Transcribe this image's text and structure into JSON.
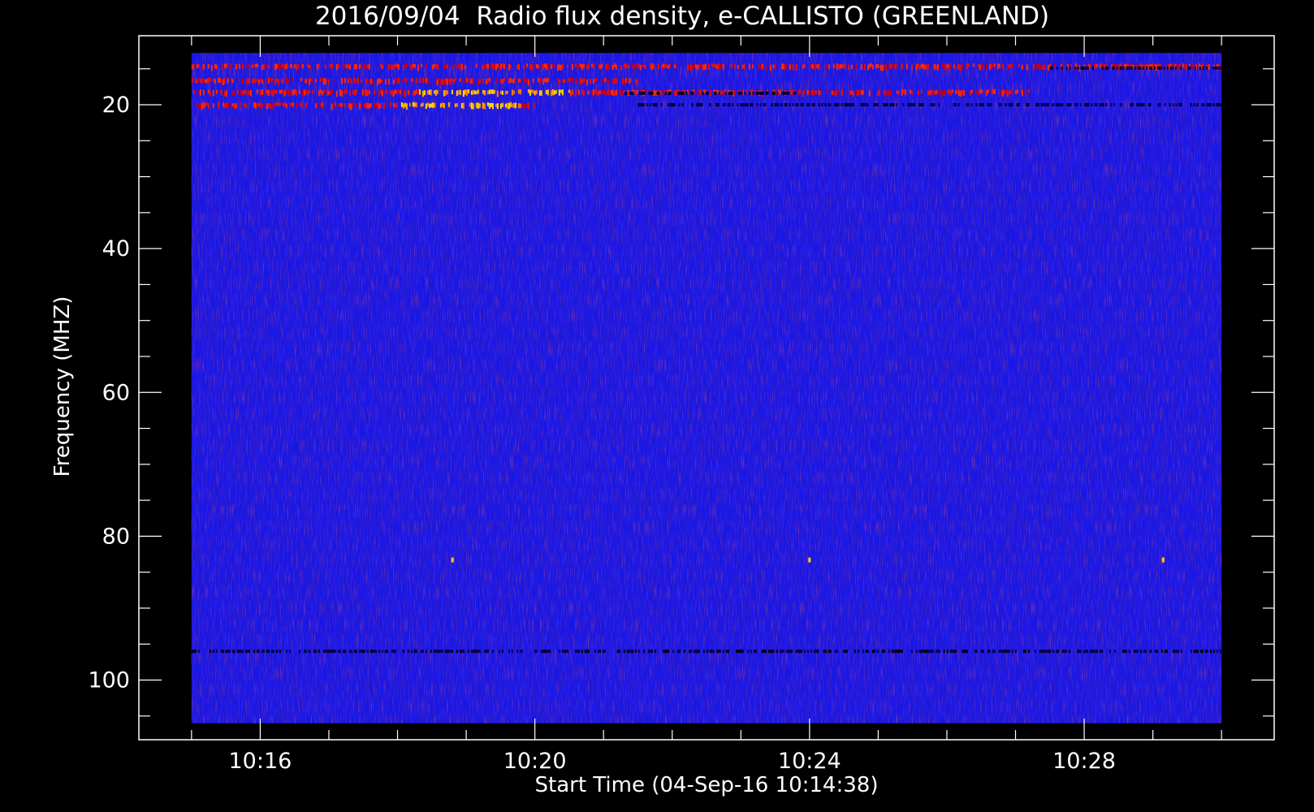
{
  "chart_data": {
    "type": "heatmap",
    "title": "2016/09/04  Radio flux density, e-CALLISTO (GREENLAND)",
    "xlabel": "Start Time (04-Sep-16 10:14:38)",
    "ylabel": "Frequency (MHZ)",
    "x_tick_labels": [
      "10:16",
      "10:20",
      "10:24",
      "10:28"
    ],
    "x_tick_values_min": [
      16,
      20,
      24,
      28
    ],
    "x_minor_tick_values_min": [
      15,
      16,
      17,
      18,
      19,
      20,
      21,
      22,
      23,
      24,
      25,
      26,
      27,
      28,
      29,
      30
    ],
    "xlim_min": [
      14.233,
      30.767
    ],
    "data_xlim_min": [
      15,
      30
    ],
    "y_tick_labels": [
      "20",
      "40",
      "60",
      "80",
      "100"
    ],
    "y_tick_values": [
      20,
      40,
      60,
      80,
      100
    ],
    "y_minor_tick_values": [
      15,
      20,
      25,
      30,
      35,
      40,
      45,
      50,
      55,
      60,
      65,
      70,
      75,
      80,
      85,
      90,
      95,
      100,
      105
    ],
    "ylim": [
      10.4,
      108.3
    ],
    "data_ylim": [
      12.8,
      106
    ],
    "y_inverted": true,
    "colormap": "blue-red-yellow",
    "background_color": "#1a17e6",
    "emission_bands": [
      {
        "freq_mhz": 14.8,
        "start_min": 15.0,
        "end_min": 30.0,
        "intensity": "red, intermittent"
      },
      {
        "freq_mhz": 16.8,
        "start_min": 15.0,
        "end_min": 21.5,
        "intensity": "red"
      },
      {
        "freq_mhz": 18.4,
        "start_min": 15.0,
        "end_min": 27.2,
        "intensity": "red-yellow, strongest 18.3-20.5 min"
      },
      {
        "freq_mhz": 20.2,
        "start_min": 15.0,
        "end_min": 20.0,
        "intensity": "orange-yellow"
      }
    ],
    "dark_bands": [
      {
        "freq_mhz": 14.9,
        "start_min": 27.5,
        "end_min": 30.0
      },
      {
        "freq_mhz": 18.4,
        "start_min": 21.3,
        "end_min": 23.8
      },
      {
        "freq_mhz": 20.0,
        "start_min": 21.5,
        "end_min": 30.0
      },
      {
        "freq_mhz": 96.0,
        "start_min": 15.0,
        "end_min": 30.0
      }
    ],
    "spikes": [
      {
        "time_min": 18.8,
        "freq_mhz": 83.3
      },
      {
        "time_min": 24.0,
        "freq_mhz": 83.3
      },
      {
        "time_min": 29.15,
        "freq_mhz": 83.3
      }
    ]
  }
}
